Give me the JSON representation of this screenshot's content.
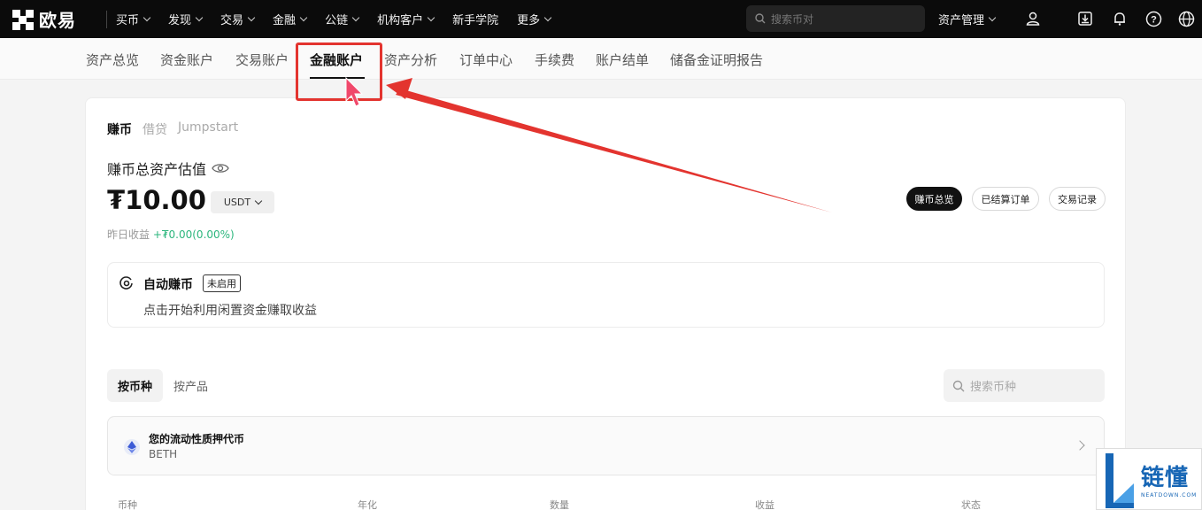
{
  "topbar": {
    "brand": "欧易",
    "nav": [
      {
        "label": "买币",
        "dropdown": true
      },
      {
        "label": "发现",
        "dropdown": true
      },
      {
        "label": "交易",
        "dropdown": true
      },
      {
        "label": "金融",
        "dropdown": true
      },
      {
        "label": "公链",
        "dropdown": true
      },
      {
        "label": "机构客户",
        "dropdown": true
      },
      {
        "label": "新手学院",
        "dropdown": false
      },
      {
        "label": "更多",
        "dropdown": true
      }
    ],
    "search_placeholder": "搜索币对",
    "asset_management": "资产管理",
    "icons": [
      "user-icon",
      "download-icon",
      "bell-icon",
      "help-icon",
      "globe-icon"
    ]
  },
  "subnav": {
    "tabs": [
      "资产总览",
      "资金账户",
      "交易账户",
      "金融账户",
      "资产分析",
      "订单中心",
      "手续费",
      "账户结单",
      "储备金证明报告"
    ],
    "active": "金融账户"
  },
  "earn": {
    "tabs": [
      "赚币",
      "借贷",
      "Jumpstart"
    ],
    "active_tab": "赚币",
    "total_label": "赚币总资产估值",
    "total_value": "₮10.00",
    "currency": "USDT",
    "yesterday_label": "昨日收益",
    "yesterday_value": "+₮0.00(0.00%)",
    "actions": [
      "赚币总览",
      "已结算订单",
      "交易记录"
    ],
    "active_action": "赚币总览"
  },
  "auto_earn": {
    "title": "自动赚币",
    "badge": "未启用",
    "description": "点击开始利用闲置资金赚取收益"
  },
  "list": {
    "tabs": [
      "按币种",
      "按产品"
    ],
    "active_tab": "按币种",
    "search_placeholder": "搜索币种",
    "promo": {
      "title": "您的流动性质押代币",
      "subtitle": "BETH"
    },
    "columns": [
      "币种",
      "年化",
      "数量",
      "收益",
      "状态"
    ]
  },
  "watermark": {
    "cn": "链懂",
    "en": "NEATDOWN.COM"
  },
  "colors": {
    "annotation": "#e3342f",
    "positive": "#2cb67d",
    "topbar": "#0b0b0b",
    "watermark": "#1766b5"
  }
}
